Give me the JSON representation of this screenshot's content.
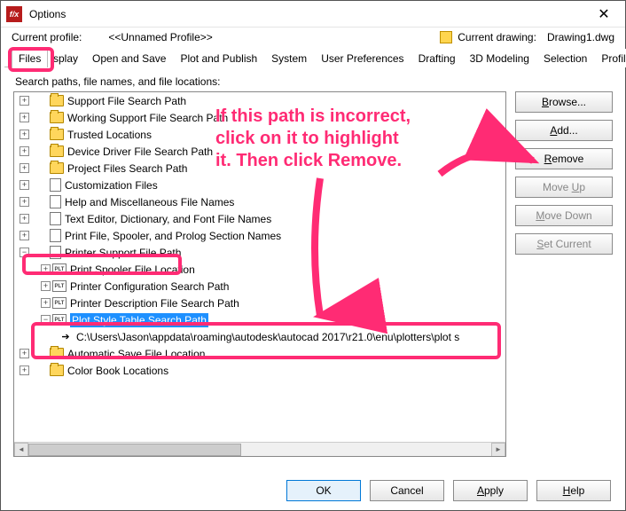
{
  "titlebar": {
    "app_icon_text": "f/x",
    "title": "Options"
  },
  "profile": {
    "label": "Current profile:",
    "value": "<<Unnamed Profile>>",
    "drawing_label": "Current drawing:",
    "drawing_value": "Drawing1.dwg"
  },
  "tabs": {
    "files": "Files",
    "display_partial": "isplay",
    "open_save": "Open and Save",
    "plot_publish": "Plot and Publish",
    "system": "System",
    "user_prefs": "User Preferences",
    "drafting": "Drafting",
    "modeling": "3D Modeling",
    "selection": "Selection",
    "profiles": "Profiles"
  },
  "search_label": "Search paths, file names, and file locations:",
  "tree": {
    "n0": "Support File Search Path",
    "n1": "Working Support File Search Path",
    "n2": "Trusted Locations",
    "n3": "Device Driver File Search Path",
    "n4": "Project Files Search Path",
    "n5": "Customization Files",
    "n6": "Help and Miscellaneous File Names",
    "n7": "Text Editor, Dictionary, and Font File Names",
    "n8": "Print File, Spooler, and Prolog Section Names",
    "n9": "Printer Support File Path",
    "n9a": "Print Spooler File Location",
    "n9b": "Printer Configuration Search Path",
    "n9c": "Printer Description File Search Path",
    "n9d": "Plot Style Table Search Path",
    "n9d_path": "C:\\Users\\Jason\\appdata\\roaming\\autodesk\\autocad 2017\\r21.0\\enu\\plotters\\plot s",
    "n10": "Automatic Save File Location",
    "n11": "Color Book Locations"
  },
  "side_buttons": {
    "browse": "Browse...",
    "add": "Add...",
    "remove": "Remove",
    "moveup": "Move Up",
    "movedown": "Move Down",
    "setcurrent": "Set Current"
  },
  "bottom_buttons": {
    "ok": "OK",
    "cancel": "Cancel",
    "apply": "Apply",
    "help": "Help"
  },
  "annotations": {
    "text_line1": "If this path is incorrect,",
    "text_line2": "click on it to highlight",
    "text_line3": "it. Then click Remove."
  }
}
